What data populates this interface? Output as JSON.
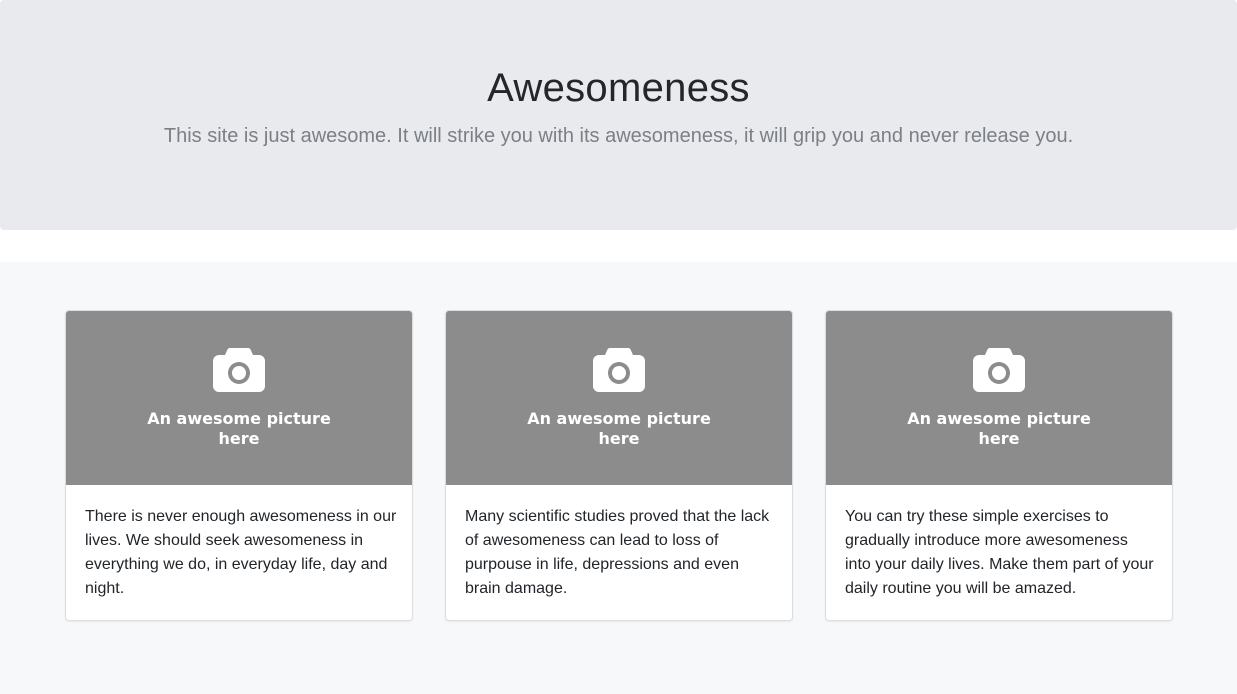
{
  "jumbotron": {
    "title": "Awesomeness",
    "lead": "This site is just awesome. It will strike you with its awesomeness, it will grip you and never release you."
  },
  "cards": [
    {
      "image_caption": "An awesome picture here",
      "image_icon": "camera-icon",
      "text": "There is never enough awesomeness in our lives. We should seek awesomeness in everything we do, in everyday life, day and night."
    },
    {
      "image_caption": "An awesome picture here",
      "image_icon": "camera-icon",
      "text": "Many scientific studies proved that the lack of awesomeness can lead to loss of purpouse in life, depressions and even brain damage."
    },
    {
      "image_caption": "An awesome picture here",
      "image_icon": "camera-icon",
      "text": "You can try these simple exercises to gradually introduce more awesomeness into your daily lives. Make them part of your daily routine you will be amazed."
    }
  ],
  "colors": {
    "jumbotron_bg": "#e9eaee",
    "album_bg": "#f7f8fa",
    "placeholder_bg": "#8c8c8c",
    "title": "#24262a",
    "lead": "#7b7f86"
  }
}
